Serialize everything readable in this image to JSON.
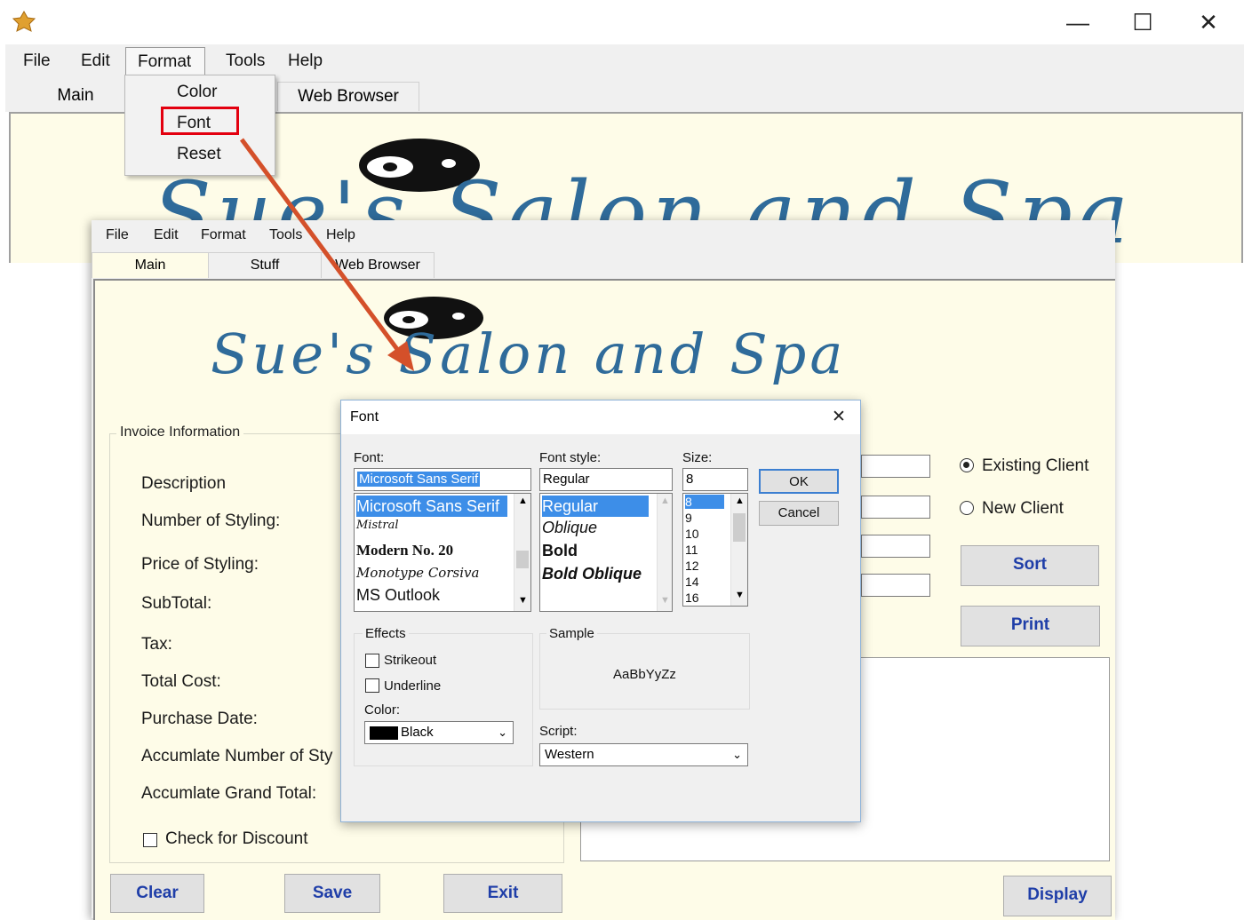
{
  "window": {
    "controls": {
      "minimize": "—",
      "maximize": "☐",
      "close": "✕"
    }
  },
  "back_window": {
    "menu": [
      "File",
      "Edit",
      "Format",
      "Tools",
      "Help"
    ],
    "tabs": [
      "Main",
      "Web Browser"
    ],
    "format_menu": [
      "Color",
      "Font",
      "Reset"
    ],
    "banner_text": "Sue's Salon and Spa"
  },
  "front_window": {
    "menu": [
      "File",
      "Edit",
      "Format",
      "Tools",
      "Help"
    ],
    "tabs": [
      "Main",
      "Stuff",
      "Web Browser"
    ],
    "banner_text": "Sue's Salon and Spa",
    "invoice_group_title": "Invoice Information",
    "labels": {
      "description": "Description",
      "number_of_styling": "Number of Styling:",
      "price_of_styling": "Price of Styling:",
      "subtotal": "SubTotal:",
      "tax": "Tax:",
      "total_cost": "Total Cost:",
      "purchase_date": "Purchase Date:",
      "accum_number": "Accumlate Number of Sty",
      "accum_grand_total": "Accumlate Grand Total:"
    },
    "check_discount": "Check for Discount",
    "radio_existing": "Existing Client",
    "radio_new": "New Client",
    "buttons": {
      "sort": "Sort",
      "print": "Print",
      "clear": "Clear",
      "save": "Save",
      "exit": "Exit",
      "display": "Display"
    },
    "accent_color": "#1f3ea8"
  },
  "font_dialog": {
    "title": "Font",
    "close": "✕",
    "font_label": "Font:",
    "font_value": "Microsoft Sans Serif",
    "font_list": [
      "Microsoft Sans Serif",
      "Mistral",
      "Modern No. 20",
      "Monotype Corsiva",
      "MS Outlook"
    ],
    "style_label": "Font style:",
    "style_value": "Regular",
    "style_list": [
      "Regular",
      "Oblique",
      "Bold",
      "Bold Oblique"
    ],
    "size_label": "Size:",
    "size_value": "8",
    "size_list": [
      "8",
      "9",
      "10",
      "11",
      "12",
      "14",
      "16"
    ],
    "ok": "OK",
    "cancel": "Cancel",
    "effects_label": "Effects",
    "strikeout": "Strikeout",
    "underline": "Underline",
    "color_label": "Color:",
    "color_value": "Black",
    "sample_label": "Sample",
    "sample_text": "AaBbYyZz",
    "script_label": "Script:",
    "script_value": "Western"
  }
}
